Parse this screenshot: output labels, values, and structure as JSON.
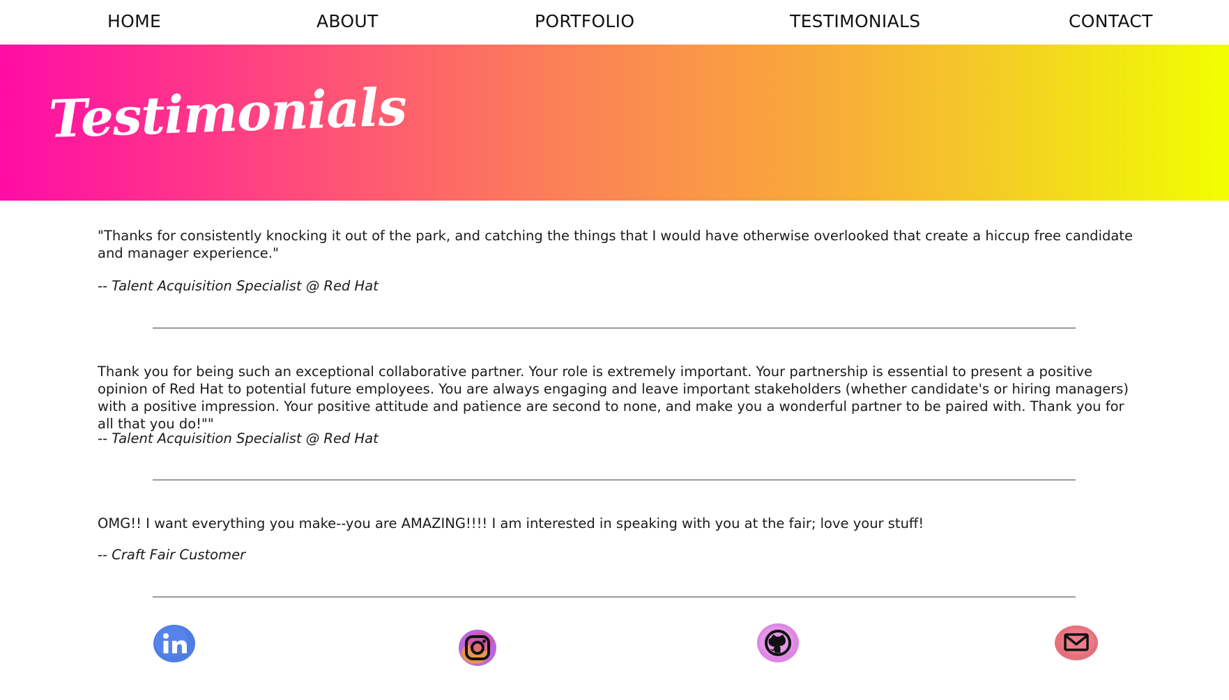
{
  "nav": {
    "items": [
      {
        "label": "HOME"
      },
      {
        "label": "ABOUT"
      },
      {
        "label": "PORTFOLIO"
      },
      {
        "label": "TESTIMONIALS"
      },
      {
        "label": "CONTACT"
      }
    ]
  },
  "banner": {
    "title": "Testimonials",
    "gradient_colors": [
      "#ff0ca6",
      "#fb7f58",
      "#f9a63c",
      "#f2ff00"
    ]
  },
  "testimonials": [
    {
      "quote": "\"Thanks for consistently knocking it out of the park, and catching the things that I would have otherwise overlooked that create a hiccup free candidate and manager experience.\"",
      "author": "-- Talent Acquisition Specialist @ Red Hat"
    },
    {
      "quote": "Thank you for being such an exceptional collaborative partner. Your role is extremely important. Your partnership is essential to present a positive opinion of Red Hat to potential future employees. You are always engaging and leave important stakeholders (whether candidate's or hiring managers) with a positive impression. Your positive attitude and patience are second to none, and make you a wonderful partner to be paired with. Thank you for all that you do!\"\"",
      "author": "-- Talent Acquisition Specialist @ Red Hat"
    },
    {
      "quote": "OMG!! I want everything you make--you are AMAZING!!!! I am interested in speaking with you at the fair; love your stuff!",
      "author": "-- Craft Fair Customer"
    }
  ],
  "social": {
    "icons": [
      "linkedin-icon",
      "instagram-icon",
      "github-icon",
      "email-icon"
    ],
    "colors": {
      "linkedin": "#3b6fe0",
      "instagram": "#b24ad6",
      "github": "#d97ae0",
      "email": "#e2606e"
    }
  }
}
